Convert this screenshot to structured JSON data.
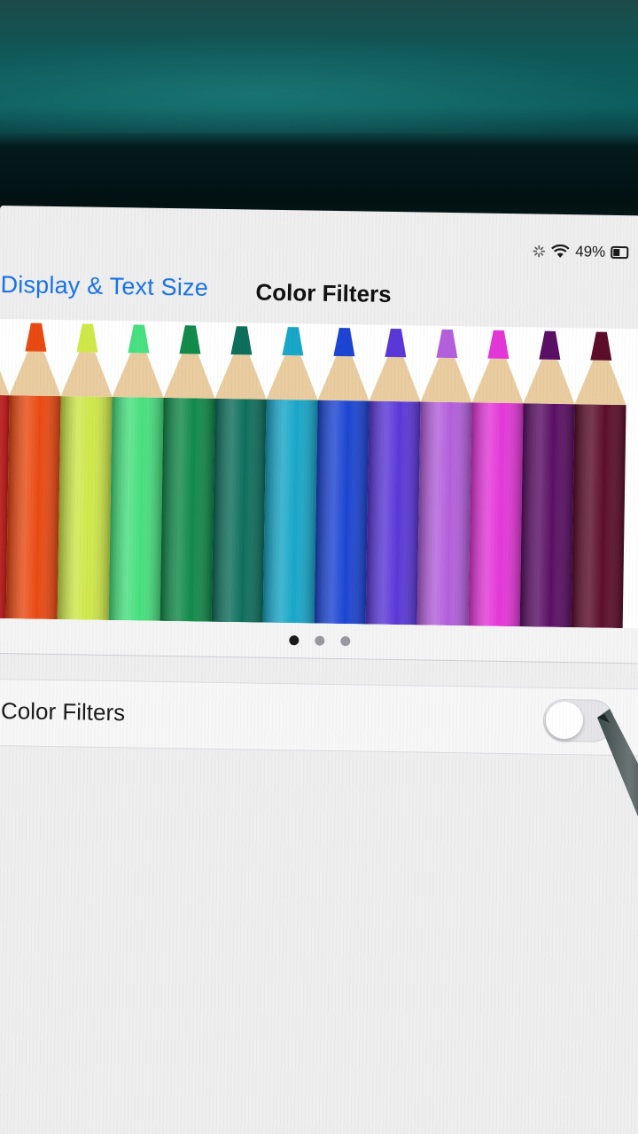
{
  "status_bar": {
    "battery_percent": "49%",
    "icons": [
      "loading-icon",
      "wifi-icon",
      "battery-icon"
    ]
  },
  "nav": {
    "back_label": "Display & Text Size",
    "title": "Color Filters"
  },
  "preview": {
    "pencil_colors": [
      "#d61e1e",
      "#ea4a12",
      "#cfe849",
      "#47e07f",
      "#118a4a",
      "#0e6f5d",
      "#18a7c9",
      "#1c45d3",
      "#5a38d8",
      "#b45fdc",
      "#e437d8",
      "#5a0f64",
      "#5c0d2a"
    ],
    "pages": 3,
    "active_page": 1
  },
  "settings": {
    "color_filters_label": "Color Filters",
    "color_filters_enabled": false
  },
  "colors": {
    "accent": "#1a73e8",
    "background": "#eeeeef"
  }
}
